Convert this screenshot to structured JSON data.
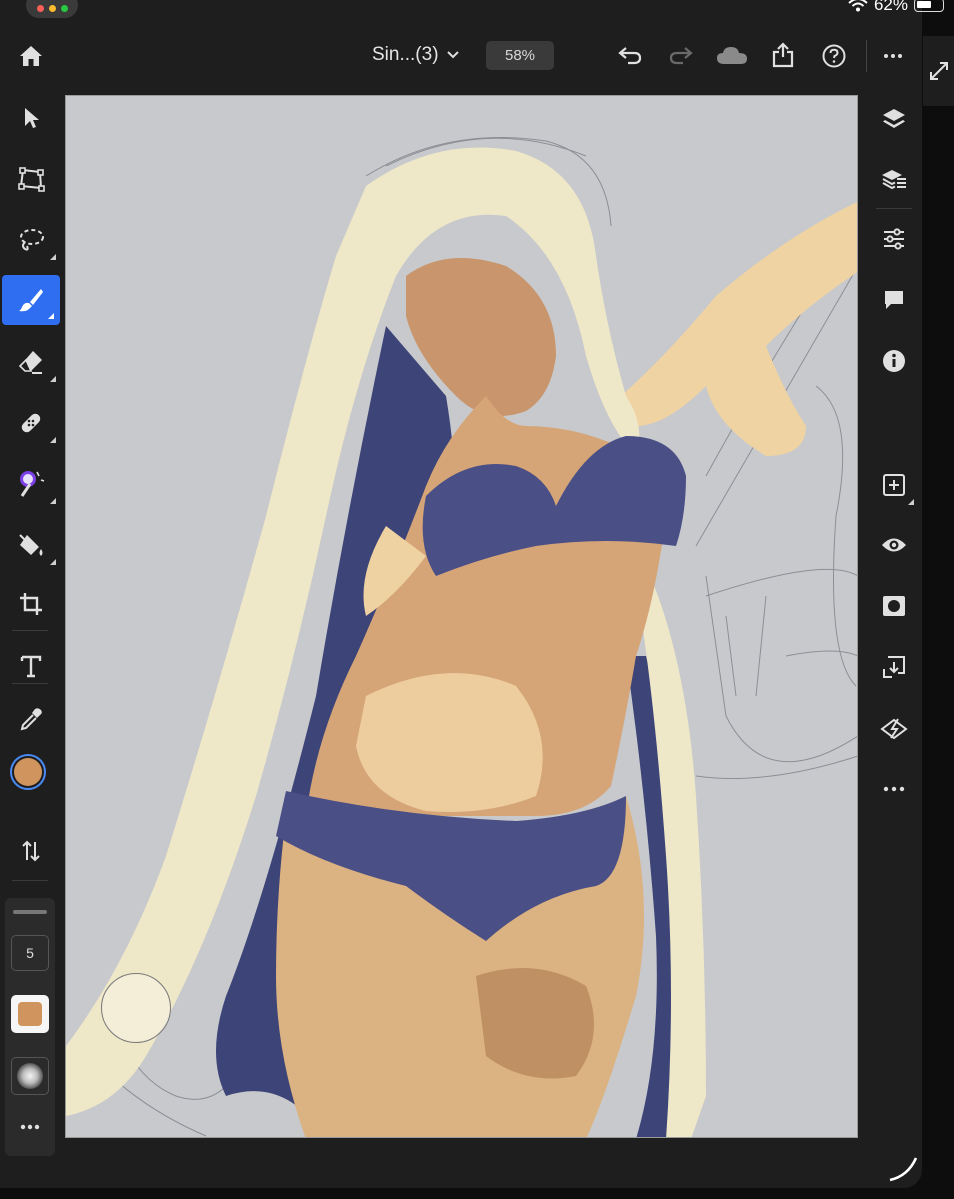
{
  "status": {
    "battery_text": "62%"
  },
  "header": {
    "document_title": "Sin...(3)",
    "zoom_label": "58%"
  },
  "tool_settings": {
    "brush_size": "5",
    "primary_color": "#d0955f",
    "secondary_color": "#8b5f44",
    "brush_color": "#d0955f"
  },
  "colors": {
    "accent": "#2f6ef0",
    "canvas_bg": "#c8c9cc",
    "app_bg": "#1e1e1e"
  },
  "left_tools": [
    "select-icon",
    "transform-icon",
    "lasso-icon",
    "brush-icon",
    "eraser-icon",
    "healing-icon",
    "magic-wand-icon",
    "fill-icon",
    "crop-icon",
    "type-icon",
    "eyedropper-icon",
    "primary-color-swatch",
    "secondary-color-swatch",
    "swap-colors-icon"
  ],
  "right_tools": [
    "layers-icon",
    "layer-properties-icon",
    "adjustments-icon",
    "comments-icon",
    "info-icon",
    "add-layer-icon",
    "visibility-icon",
    "mask-icon",
    "merge-down-icon",
    "clear-icon",
    "more-icon"
  ]
}
